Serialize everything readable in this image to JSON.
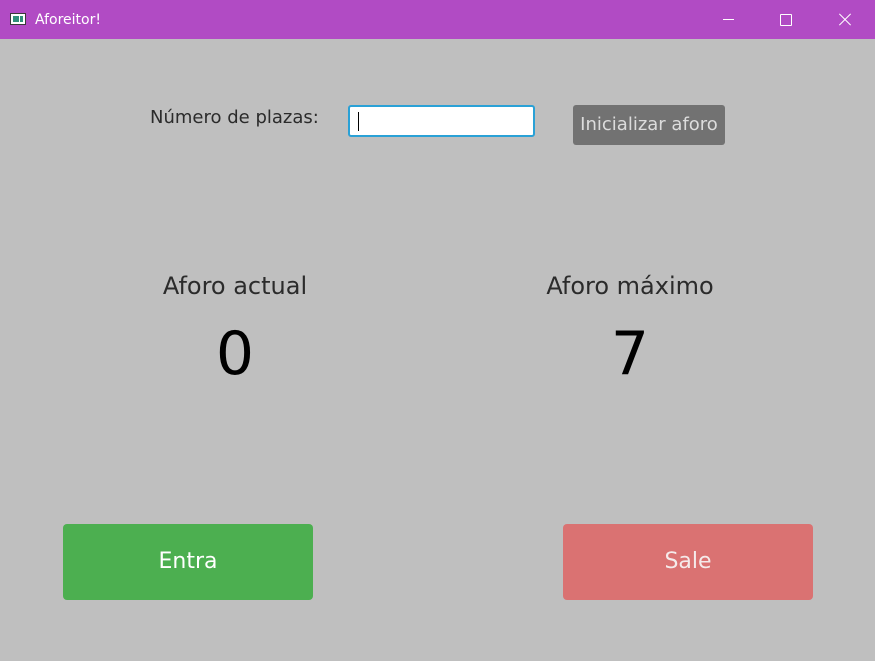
{
  "window": {
    "title": "Aforeitor!",
    "titlebar_color": "#b14bc4",
    "icons": {
      "app": "app-window-icon",
      "minimize": "minimize-icon",
      "maximize": "maximize-icon",
      "close": "close-icon"
    }
  },
  "form": {
    "plazas_label": "Número de plazas:",
    "plazas_value": "",
    "init_button_label": "Inicializar aforo"
  },
  "stats": {
    "current_label": "Aforo actual",
    "current_value": "0",
    "max_label": "Aforo máximo",
    "max_value": "7"
  },
  "actions": {
    "enter_label": "Entra",
    "enter_color": "#4caf50",
    "exit_label": "Sale",
    "exit_color": "#da7272"
  }
}
